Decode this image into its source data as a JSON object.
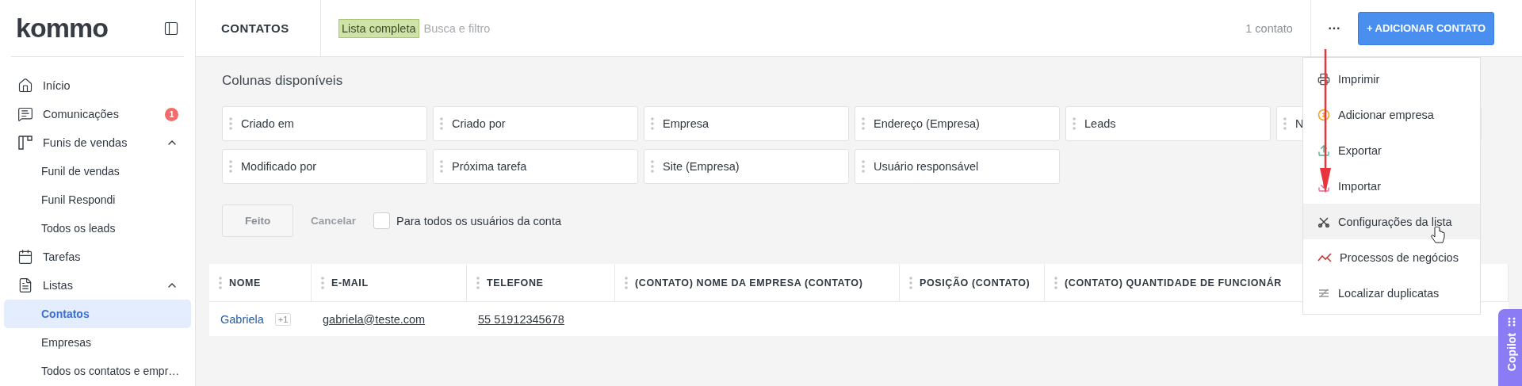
{
  "sidebar": {
    "logo": "kommo",
    "items": [
      {
        "label": "Início",
        "selected": false
      },
      {
        "label": "Comunicações",
        "selected": false,
        "badge": "1"
      },
      {
        "label": "Funis de vendas",
        "selected": false,
        "expanded": true,
        "children": [
          {
            "label": "Funil de vendas",
            "selected": false
          },
          {
            "label": "Funil Respondi",
            "selected": false
          },
          {
            "label": "Todos os leads",
            "selected": false
          }
        ]
      },
      {
        "label": "Tarefas",
        "selected": false
      },
      {
        "label": "Listas",
        "selected": false,
        "expanded": true,
        "children": [
          {
            "label": "Contatos",
            "selected": true
          },
          {
            "label": "Empresas",
            "selected": false
          },
          {
            "label": "Todos os contatos e empr…",
            "selected": false
          }
        ]
      }
    ]
  },
  "header": {
    "title": "CONTATOS",
    "filter_tag": "Lista completa",
    "search": {
      "placeholder": "Busca e filtro"
    },
    "count": "1 contato",
    "more": "···",
    "add_button": "+ ADICIONAR CONTATO"
  },
  "columns_panel": {
    "title": "Colunas disponíveis",
    "columns": [
      "Criado em",
      "Criado por",
      "Empresa",
      "Endereço (Empresa)",
      "Leads",
      "N",
      "Modificado por",
      "Próxima tarefa",
      "Site (Empresa)",
      "Usuário responsável"
    ],
    "done": "Feito",
    "cancel": "Cancelar",
    "all_users": {
      "label": "Para todos os usuários da conta",
      "checked": false
    }
  },
  "table": {
    "columns": [
      "NOME",
      "E-MAIL",
      "TELEFONE",
      "(CONTATO) NOME DA EMPRESA (CONTATO)",
      "POSIÇÃO (CONTATO)",
      "(CONTATO) QUANTIDADE DE FUNCIONÁR"
    ],
    "rows": [
      {
        "name": "Gabriela",
        "extra": "+1",
        "email": "gabriela@teste.com",
        "phone": "55 51912345678"
      }
    ]
  },
  "menu": {
    "items": [
      {
        "label": "Imprimir",
        "hovered": false
      },
      {
        "label": "Adicionar empresa",
        "hovered": false
      },
      {
        "label": "Exportar",
        "hovered": false
      },
      {
        "label": "Importar",
        "hovered": false
      },
      {
        "label": "Configurações da lista",
        "hovered": true
      },
      {
        "label": "Processos de negócios",
        "hovered": false
      },
      {
        "label": "Localizar duplicatas",
        "hovered": false
      }
    ]
  },
  "copilot": {
    "label": "Copilot"
  }
}
